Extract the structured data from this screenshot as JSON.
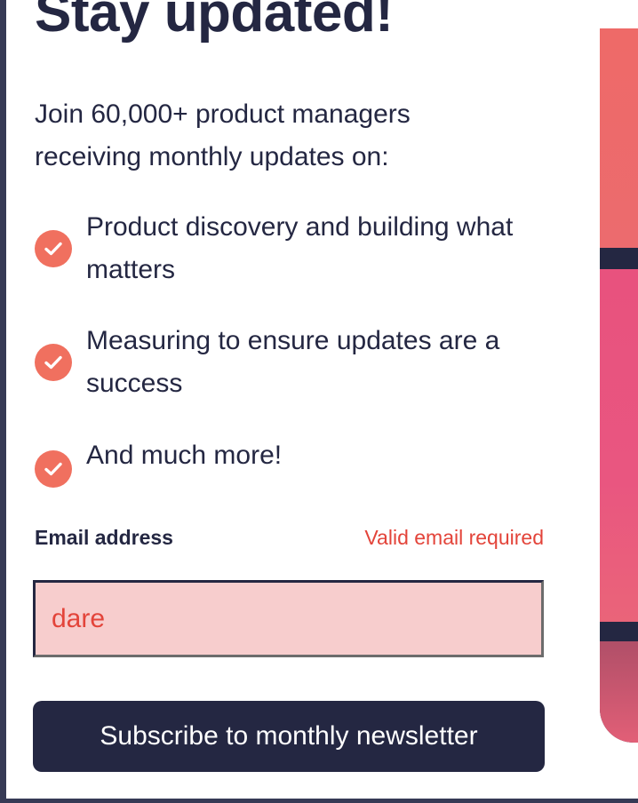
{
  "newsletter": {
    "title": "Stay updated!",
    "intro": "Join 60,000+ product managers receiving monthly updates on:",
    "features": [
      "Product discovery and building what matters",
      "Measuring to ensure updates are a success",
      "And much more!"
    ],
    "email_label": "Email address",
    "email_error": "Valid email required",
    "email_value": "dare",
    "subscribe_label": "Subscribe to monthly newsletter"
  },
  "icons": {
    "feature_icon": "check-circle-icon"
  },
  "colors": {
    "dark_navy": "#242742",
    "tomato": "#f0705f",
    "error_red": "#e3443a",
    "error_bg": "#f7cdcd",
    "frame": "#363a55"
  }
}
